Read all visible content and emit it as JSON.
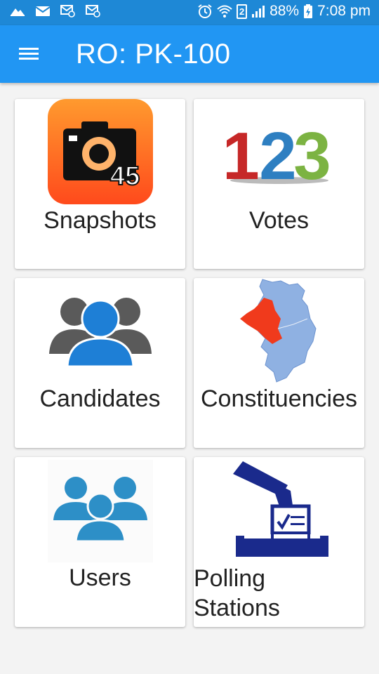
{
  "status_bar": {
    "battery": "88%",
    "time": "7:08 pm",
    "sim_number": "2"
  },
  "app_bar": {
    "title": "RO: PK-100"
  },
  "tiles": [
    {
      "label": "Snapshots",
      "badge": "45",
      "icon": "camera-icon"
    },
    {
      "label": "Votes",
      "icon": "numbers-123-icon",
      "digits": [
        "1",
        "2",
        "3"
      ]
    },
    {
      "label": "Candidates",
      "icon": "people-group-icon"
    },
    {
      "label": "Constituencies",
      "icon": "map-icon"
    },
    {
      "label": "Users",
      "icon": "users-group-icon"
    },
    {
      "label_line1": "Polling",
      "label_line2": "Stations",
      "icon": "ballot-box-icon"
    }
  ],
  "colors": {
    "status_bar": "#1e88d6",
    "app_bar": "#2196f3",
    "background": "#f3f3f3"
  }
}
